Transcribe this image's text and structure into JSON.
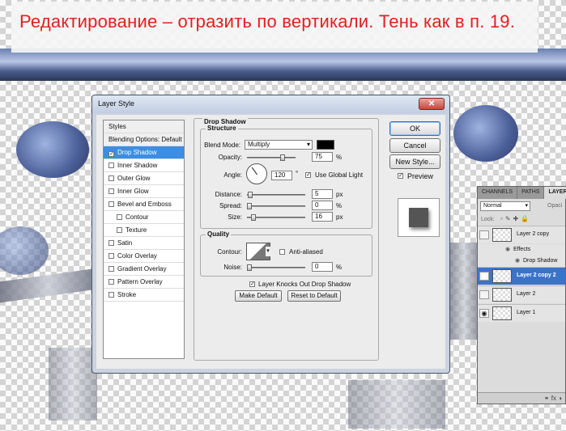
{
  "banner": {
    "text": "Редактирование – отразить по вертикали. Тень как в п. 19."
  },
  "dialog": {
    "title": "Layer Style",
    "close_glyph": "✕",
    "styles_list": [
      {
        "label": "Styles",
        "type": "header"
      },
      {
        "label": "Blending Options: Default",
        "type": "header"
      },
      {
        "label": "Drop Shadow",
        "checked": true,
        "selected": true
      },
      {
        "label": "Inner Shadow",
        "checked": false
      },
      {
        "label": "Outer Glow",
        "checked": false
      },
      {
        "label": "Inner Glow",
        "checked": false
      },
      {
        "label": "Bevel and Emboss",
        "checked": false
      },
      {
        "label": "Contour",
        "checked": false,
        "indent": true
      },
      {
        "label": "Texture",
        "checked": false,
        "indent": true
      },
      {
        "label": "Satin",
        "checked": false
      },
      {
        "label": "Color Overlay",
        "checked": false
      },
      {
        "label": "Gradient Overlay",
        "checked": false
      },
      {
        "label": "Pattern Overlay",
        "checked": false
      },
      {
        "label": "Stroke",
        "checked": false
      }
    ],
    "drop_shadow": {
      "section_title": "Drop Shadow",
      "structure_title": "Structure",
      "blend_mode_label": "Blend Mode:",
      "blend_mode_value": "Multiply",
      "shadow_color": "#000000",
      "opacity_label": "Opacity:",
      "opacity_value": "75",
      "opacity_unit": "%",
      "angle_label": "Angle:",
      "angle_value": "120",
      "angle_unit": "°",
      "use_global_light_label": "Use Global Light",
      "use_global_light_checked": true,
      "distance_label": "Distance:",
      "distance_value": "5",
      "distance_unit": "px",
      "spread_label": "Spread:",
      "spread_value": "0",
      "spread_unit": "%",
      "size_label": "Size:",
      "size_value": "16",
      "size_unit": "px",
      "quality_title": "Quality",
      "contour_label": "Contour:",
      "anti_aliased_label": "Anti-aliased",
      "anti_aliased_checked": false,
      "noise_label": "Noise:",
      "noise_value": "0",
      "noise_unit": "%",
      "knocks_out_label": "Layer Knocks Out Drop Shadow",
      "knocks_out_checked": true,
      "make_default_label": "Make Default",
      "reset_default_label": "Reset to Default"
    },
    "buttons": {
      "ok": "OK",
      "cancel": "Cancel",
      "new_style": "New Style..."
    },
    "preview_label": "Preview",
    "preview_checked": true
  },
  "layers_panel": {
    "tabs": [
      "CHANNELS",
      "PATHS",
      "LAYER"
    ],
    "blend_mode": "Normal",
    "opacity_label": "Opaci",
    "lock_label": "Lock:",
    "layers": [
      {
        "name": "Layer 2 copy",
        "visible": false,
        "selected": false
      },
      {
        "name": "Effects",
        "sub": true
      },
      {
        "name": "Drop Shadow",
        "sub": true
      },
      {
        "name": "Layer 2 copy 2",
        "visible": true,
        "selected": true
      },
      {
        "name": "Layer 2",
        "visible": false,
        "selected": false
      },
      {
        "name": "Layer 1",
        "visible": true,
        "selected": false
      }
    ],
    "footer_icons": "⚭ fx ◑"
  },
  "colors": {
    "accent": "#3b8ee4",
    "banner_text": "#e02020",
    "selected_layer": "#3b73c8"
  }
}
